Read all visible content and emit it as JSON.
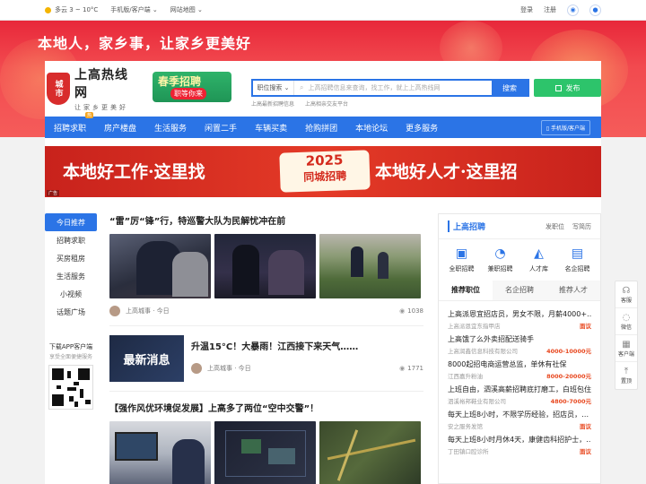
{
  "topbar": {
    "weather": "多云 3 ~ 10°C",
    "mobile_link": "手机版/客户端",
    "sitemap": "网站地图",
    "login": "登录",
    "register": "注册"
  },
  "banner": {
    "slogan": "本地人，家乡事，让家乡更美好"
  },
  "logo": {
    "seal": "城市",
    "name": "上高热线网",
    "subtitle": "让家乡更美好"
  },
  "promo": {
    "line1": "春季招聘",
    "line2": "职等你来"
  },
  "search": {
    "category": "职位搜索",
    "placeholder": "上高招聘信息来查询，找工作，就上上高热线网",
    "button": "搜索",
    "hint1": "上高最新招聘信息",
    "hint2": "上高相亲交友平台"
  },
  "publish_button": "发布",
  "nav": {
    "items": [
      "招聘求职",
      "房产楼盘",
      "生活服务",
      "闲置二手",
      "车辆买卖",
      "抢购拼团",
      "本地论坛",
      "更多服务"
    ],
    "hot_badge": "热",
    "mobile": "手机版/客户端"
  },
  "ad": {
    "left": "本地好工作·这里找",
    "year": "2025",
    "mid": "同城招聘",
    "right": "本地好人才·这里招",
    "tag": "广告"
  },
  "leftnav": {
    "items": [
      "今日推荐",
      "招聘求职",
      "买房租房",
      "生活服务",
      "小视频",
      "话题广场"
    ],
    "app_title": "下载APP客户端",
    "app_sub": "享受全面便捷服务"
  },
  "feed": [
    {
      "title": "“雷”厉“锋”行，特巡警大队为民解忧冲在前",
      "author": "上高城事 · 今日",
      "views": "1038"
    },
    {
      "title": "升温15°C！大暴雨！江西接下来天气……",
      "thumb_text": "最新消息",
      "author": "上高城事 · 今日",
      "views": "1771"
    },
    {
      "title": "【强作风优环境促发展】上高多了两位“空中交警”！"
    }
  ],
  "right": {
    "title": "上高招聘",
    "link1": "发职位",
    "link2": "写简历",
    "icons": [
      {
        "label": "全职招聘",
        "icon": "briefcase-icon"
      },
      {
        "label": "兼职招聘",
        "icon": "part-time-icon"
      },
      {
        "label": "人才库",
        "icon": "graduation-cap-icon"
      },
      {
        "label": "名企招聘",
        "icon": "building-icon"
      }
    ],
    "tabs": [
      "推荐职位",
      "名企招聘",
      "推荐人才"
    ],
    "jobs": [
      {
        "title": "上高派恩宜招店员，男女不限，月薪4000+…",
        "company": "上高派恩宜东指甲店",
        "salary": "面议"
      },
      {
        "title": "上高饿了么外卖招配送骑手",
        "company": "上高润鑫信息科技有限公司",
        "salary": "4000-10000元"
      },
      {
        "title": "8000起招电商运营总监，单休有社保",
        "company": "江西嘉升粉油",
        "salary": "8000-20000元"
      },
      {
        "title": "上班自由，泗溪高薪招聘底打磨工，白班包住",
        "company": "泗溪裕邦鞋业有限公司",
        "salary": "4800-7000元"
      },
      {
        "title": "每天上班8小时，不限学历经验，招店员，…",
        "company": "安之服务发馆",
        "salary": "面议"
      },
      {
        "title": "每天上班8小时月休4天，康健齿科招护士，…",
        "company": "丁田镇口腔诊所",
        "salary": "面议"
      }
    ]
  },
  "float": [
    "客服",
    "微信",
    "客户端",
    "置顶"
  ]
}
